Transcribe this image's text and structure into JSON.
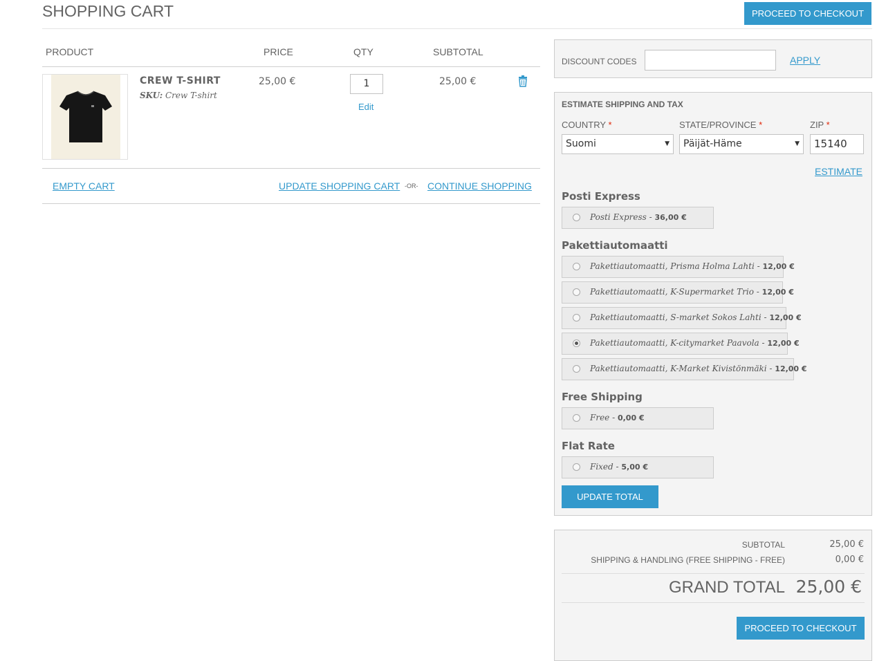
{
  "header": {
    "title": "SHOPPING CART",
    "checkout_label": "PROCEED TO CHECKOUT"
  },
  "cart_table": {
    "columns": {
      "product": "PRODUCT",
      "price": "PRICE",
      "qty": "QTY",
      "subtotal": "SUBTOTAL"
    },
    "items": [
      {
        "name": "CREW T-SHIRT",
        "sku_label": "SKU:",
        "sku_value": "Crew T-shirt",
        "price": "25,00 €",
        "qty": "1",
        "edit_label": "Edit",
        "subtotal": "25,00 €",
        "remove_icon": "trash-icon"
      }
    ],
    "actions": {
      "empty_cart": "EMPTY CART",
      "update_cart": "UPDATE SHOPPING CART",
      "or": "-OR-",
      "continue_shopping": "CONTINUE SHOPPING"
    }
  },
  "discount": {
    "label": "DISCOUNT CODES",
    "value": "",
    "apply_label": "APPLY"
  },
  "shipping": {
    "title": "ESTIMATE SHIPPING AND TAX",
    "country_label": "COUNTRY",
    "country_value": "Suomi",
    "state_label": "STATE/PROVINCE",
    "state_value": "Päijät-Häme",
    "zip_label": "ZIP",
    "zip_value": "15140",
    "required_mark": "*",
    "estimate_label": "ESTIMATE",
    "groups": [
      {
        "name": "Posti Express",
        "options": [
          {
            "label": "Posti Express",
            "price": "36,00 €",
            "selected": false
          }
        ]
      },
      {
        "name": "Pakettiautomaatti",
        "options": [
          {
            "label": "Pakettiautomaatti, Prisma Holma Lahti",
            "price": "12,00 €",
            "selected": false
          },
          {
            "label": "Pakettiautomaatti, K-Supermarket Trio",
            "price": "12,00 €",
            "selected": false
          },
          {
            "label": "Pakettiautomaatti, S-market Sokos Lahti",
            "price": "12,00 €",
            "selected": false
          },
          {
            "label": "Pakettiautomaatti, K-citymarket Paavola",
            "price": "12,00 €",
            "selected": true
          },
          {
            "label": "Pakettiautomaatti, K-Market Kivistönmäki",
            "price": "12,00 €",
            "selected": false
          }
        ]
      },
      {
        "name": "Free Shipping",
        "options": [
          {
            "label": "Free",
            "price": "0,00 €",
            "selected": false
          }
        ]
      },
      {
        "name": "Flat Rate",
        "options": [
          {
            "label": "Fixed",
            "price": "5,00 €",
            "selected": false
          }
        ]
      }
    ],
    "update_total_label": "UPDATE TOTAL"
  },
  "totals": {
    "subtotal_label": "SUBTOTAL",
    "subtotal_value": "25,00 €",
    "shipping_label": "SHIPPING & HANDLING (FREE SHIPPING - FREE)",
    "shipping_value": "0,00 €",
    "grand_total_label": "GRAND TOTAL",
    "grand_total_value": "25,00 €",
    "checkout_label": "PROCEED TO CHECKOUT"
  },
  "colors": {
    "accent": "#3399cc",
    "text": "#636363",
    "panel_bg": "#f4f4f4",
    "required": "#df280a"
  }
}
